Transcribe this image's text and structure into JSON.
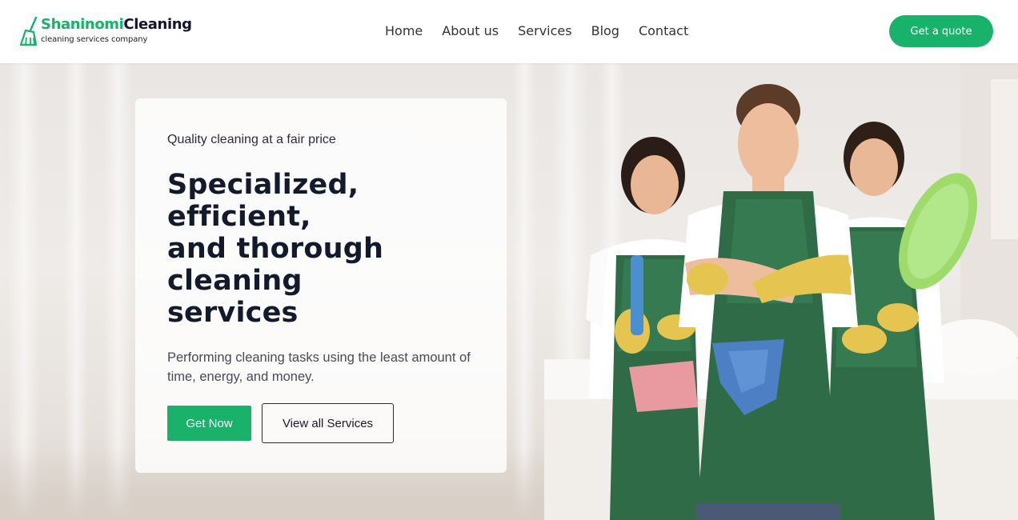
{
  "brand": {
    "name_part1": "Shaninomi",
    "name_part2": "Cleaning",
    "tagline": "cleaning services company",
    "logo_icon": "broom-icon",
    "accent_color": "#19b26b"
  },
  "nav": {
    "items": [
      {
        "label": "Home"
      },
      {
        "label": "About us"
      },
      {
        "label": "Services"
      },
      {
        "label": "Blog"
      },
      {
        "label": "Contact"
      }
    ]
  },
  "header": {
    "quote_button": "Get a quote"
  },
  "hero": {
    "eyebrow": "Quality cleaning at a fair price",
    "headline_lines": [
      "Specialized,",
      "efficient,",
      "and thorough",
      "cleaning",
      "services"
    ],
    "subtitle": "Performing cleaning tasks using the least amount of time, energy, and money.",
    "primary_button": "Get Now",
    "secondary_button": "View all Services"
  }
}
